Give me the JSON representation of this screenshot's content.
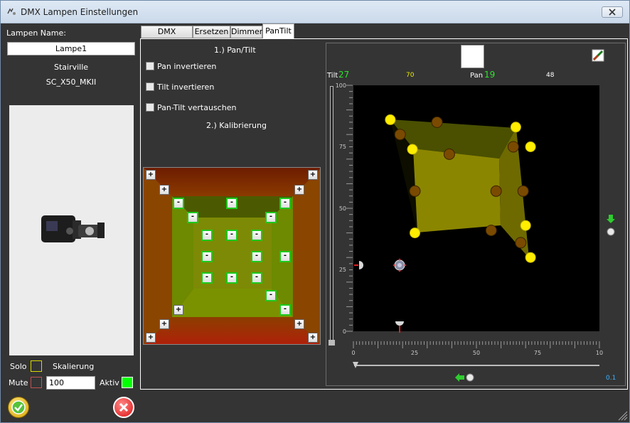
{
  "window": {
    "title": "DMX Lampen Einstellungen",
    "icon": "app-icon",
    "close": "close-icon"
  },
  "left": {
    "name_label": "Lampen Name:",
    "name_value": "Lampe1",
    "manufacturer": "Stairville",
    "model": "SC_X50_MKII",
    "solo_label": "Solo",
    "scaling_label": "Skalierung",
    "mute_label": "Mute",
    "scaling_value": "100",
    "active_label": "Aktiv",
    "solo_color": "#d8d800",
    "mute_color": "#c04040",
    "active_color": "#00ff00"
  },
  "buttons": {
    "ok": "check-icon",
    "cancel": "cancel-icon"
  },
  "tabs": [
    {
      "label": "DMX Adresse",
      "active": false
    },
    {
      "label": "Ersetzen",
      "active": false
    },
    {
      "label": "Dimmer",
      "active": false
    },
    {
      "label": "PanTilt",
      "active": true
    }
  ],
  "pantilt": {
    "section1": "1.) Pan/Tilt",
    "pan_invert": "Pan invertieren",
    "tilt_invert": "Tilt invertieren",
    "swap": "Pan-Tilt vertauschen",
    "section2": "2.) Kalibrierung",
    "plus": "+",
    "minus": "-"
  },
  "viewer": {
    "tilt_label": "Tilt",
    "tilt_value": "27",
    "tilt_value2": "70",
    "pan_label": "Pan",
    "pan_value": "19",
    "pan_value2": "48",
    "y_ticks": [
      "100",
      "75",
      "50",
      "25",
      "0"
    ],
    "x_ticks": [
      "0",
      "25",
      "50",
      "75",
      "10"
    ],
    "slider_value": "0.1"
  },
  "chart_data": {
    "type": "scatter",
    "title": "",
    "xlabel": "",
    "ylabel": "",
    "xlim": [
      0,
      100
    ],
    "ylim": [
      0,
      100
    ],
    "grid": false,
    "series": [
      {
        "values_x": [
          15,
          24,
          66,
          72,
          25,
          70,
          72
        ],
        "values_y": [
          86,
          74,
          83,
          75,
          40,
          43,
          30
        ],
        "color": "#ffee00"
      },
      {
        "values_x": [
          19,
          34,
          39,
          25,
          56,
          58,
          69,
          65,
          68
        ],
        "values_y": [
          80,
          85,
          72,
          57,
          41,
          57,
          57,
          75,
          36
        ],
        "color": "#7a4a00"
      }
    ]
  }
}
